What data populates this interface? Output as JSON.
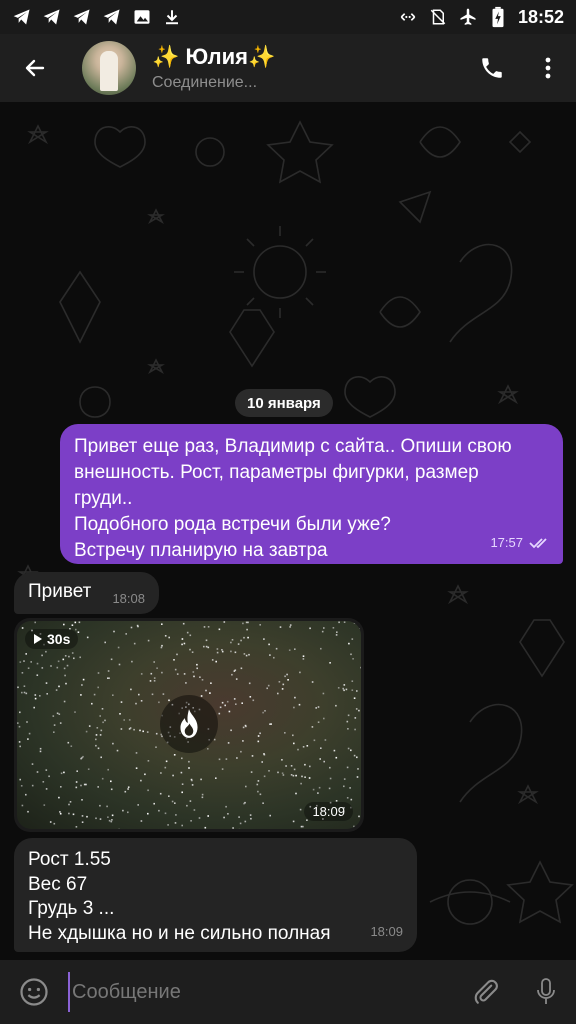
{
  "statusbar": {
    "time": "18:52",
    "left_icons": [
      "telegram-icon",
      "telegram-icon",
      "telegram-icon",
      "telegram-icon",
      "image-icon",
      "download-icon"
    ],
    "right_icons": [
      "data-saver-icon",
      "no-sim-icon",
      "airplane-icon",
      "battery-charging-icon"
    ]
  },
  "header": {
    "contact_name": "✨ Юлия✨",
    "status": "Соединение..."
  },
  "chat": {
    "date_label": "10 января",
    "messages": [
      {
        "direction": "outgoing",
        "text": "Привет еще раз, Владимир с сайта.. Опиши свою\nвнешность. Рост, параметры фигурки, размер\nгруди..\nПодобного рода встречи были уже?\nВстречу планирую на завтра",
        "time": "17:57",
        "status": "read"
      },
      {
        "direction": "incoming",
        "text": "Привет",
        "time": "18:08"
      },
      {
        "direction": "incoming",
        "type": "video",
        "duration": "30s",
        "time": "18:09"
      },
      {
        "direction": "incoming",
        "text": "Рост 1.55\nВес 67\nГрудь 3 ...\nНе хдышка но и не сильно полная",
        "time": "18:09"
      }
    ]
  },
  "input": {
    "placeholder": "Сообщение"
  },
  "colors": {
    "outgoing_bubble": "#7c3fc7",
    "incoming_bubble": "#242424",
    "header_bg": "#1f1f1f",
    "chat_bg": "#0c0c0c"
  }
}
